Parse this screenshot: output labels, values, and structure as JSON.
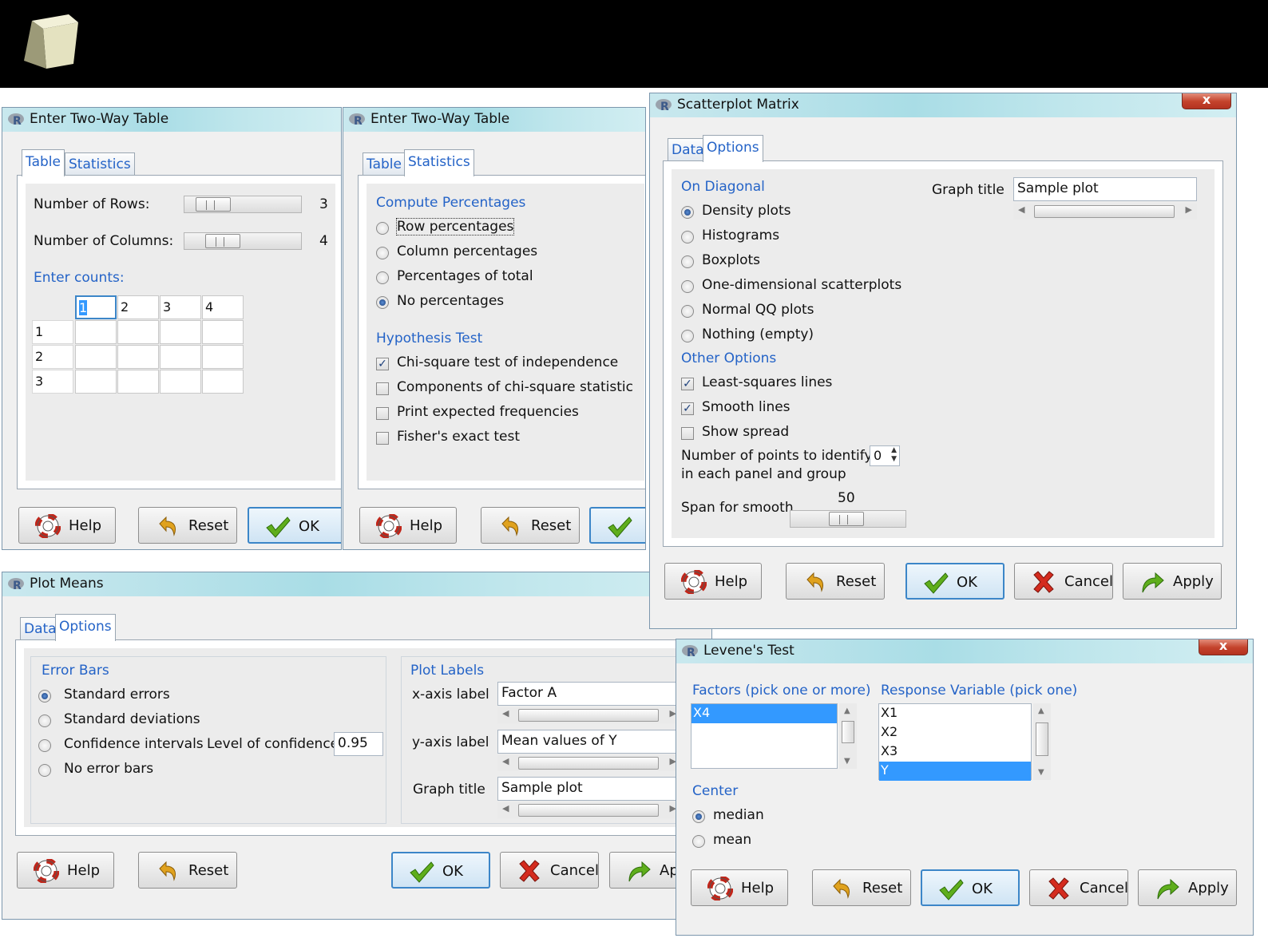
{
  "colors": {
    "accent": "#2463c7",
    "selection": "#3399ff",
    "title_bar": "#a9dde6"
  },
  "buttons": {
    "help": "Help",
    "reset": "Reset",
    "ok": "OK",
    "cancel": "Cancel",
    "apply": "Apply",
    "apply_partial": "Ap"
  },
  "two_way_table": {
    "title": "Enter Two-Way Table",
    "tabs": [
      "Table",
      "Statistics"
    ],
    "rows_label": "Number of Rows:",
    "rows_value": "3",
    "cols_label": "Number of Columns:",
    "cols_value": "4",
    "counts_label": "Enter counts:",
    "col_headers": [
      "1",
      "2",
      "3",
      "4"
    ],
    "row_headers": [
      "1",
      "2",
      "3"
    ]
  },
  "two_way_stats": {
    "title": "Enter Two-Way Table",
    "tabs": [
      "Table",
      "Statistics"
    ],
    "compute_heading": "Compute Percentages",
    "percent_options": [
      "Row percentages",
      "Column percentages",
      "Percentages of total",
      "No percentages"
    ],
    "hypothesis_heading": "Hypothesis Test",
    "tests": [
      "Chi-square test of independence",
      "Components of chi-square statistic",
      "Print expected frequencies",
      "Fisher's exact test"
    ]
  },
  "scatterplot_matrix": {
    "title": "Scatterplot Matrix",
    "close": "x",
    "tabs": [
      "Data",
      "Options"
    ],
    "diagonal_heading": "On Diagonal",
    "diagonal_options": [
      "Density plots",
      "Histograms",
      "Boxplots",
      "One-dimensional scatterplots",
      "Normal QQ plots",
      "Nothing (empty)"
    ],
    "other_heading": "Other Options",
    "other_options": [
      "Least-squares lines",
      "Smooth lines",
      "Show spread"
    ],
    "identify_label_1": "Number of points to identify",
    "identify_label_2": "in each panel and group",
    "identify_value": "0",
    "span_label": "Span for smooth",
    "span_value": "50",
    "graph_title_label": "Graph title",
    "graph_title_value": "Sample plot"
  },
  "plot_means": {
    "title": "Plot Means",
    "tabs": [
      "Data",
      "Options"
    ],
    "error_heading": "Error Bars",
    "error_options": [
      "Standard errors",
      "Standard deviations",
      "Confidence intervals",
      "No error bars"
    ],
    "confidence_label": "Level of confidence:",
    "confidence_value": "0.95",
    "labels_heading": "Plot Labels",
    "x_label": "x-axis label",
    "x_value": "Factor A",
    "y_label": "y-axis label",
    "y_value": "Mean values of Y",
    "graph_title_label": "Graph title",
    "graph_title_value": "Sample plot"
  },
  "levene": {
    "title": "Levene's Test",
    "close": "x",
    "factors_heading": "Factors (pick one or more)",
    "factors": [
      "X4"
    ],
    "response_heading": "Response Variable (pick one)",
    "responses": [
      "X1",
      "X2",
      "X3",
      "Y"
    ],
    "center_heading": "Center",
    "center_options": [
      "median",
      "mean"
    ]
  }
}
